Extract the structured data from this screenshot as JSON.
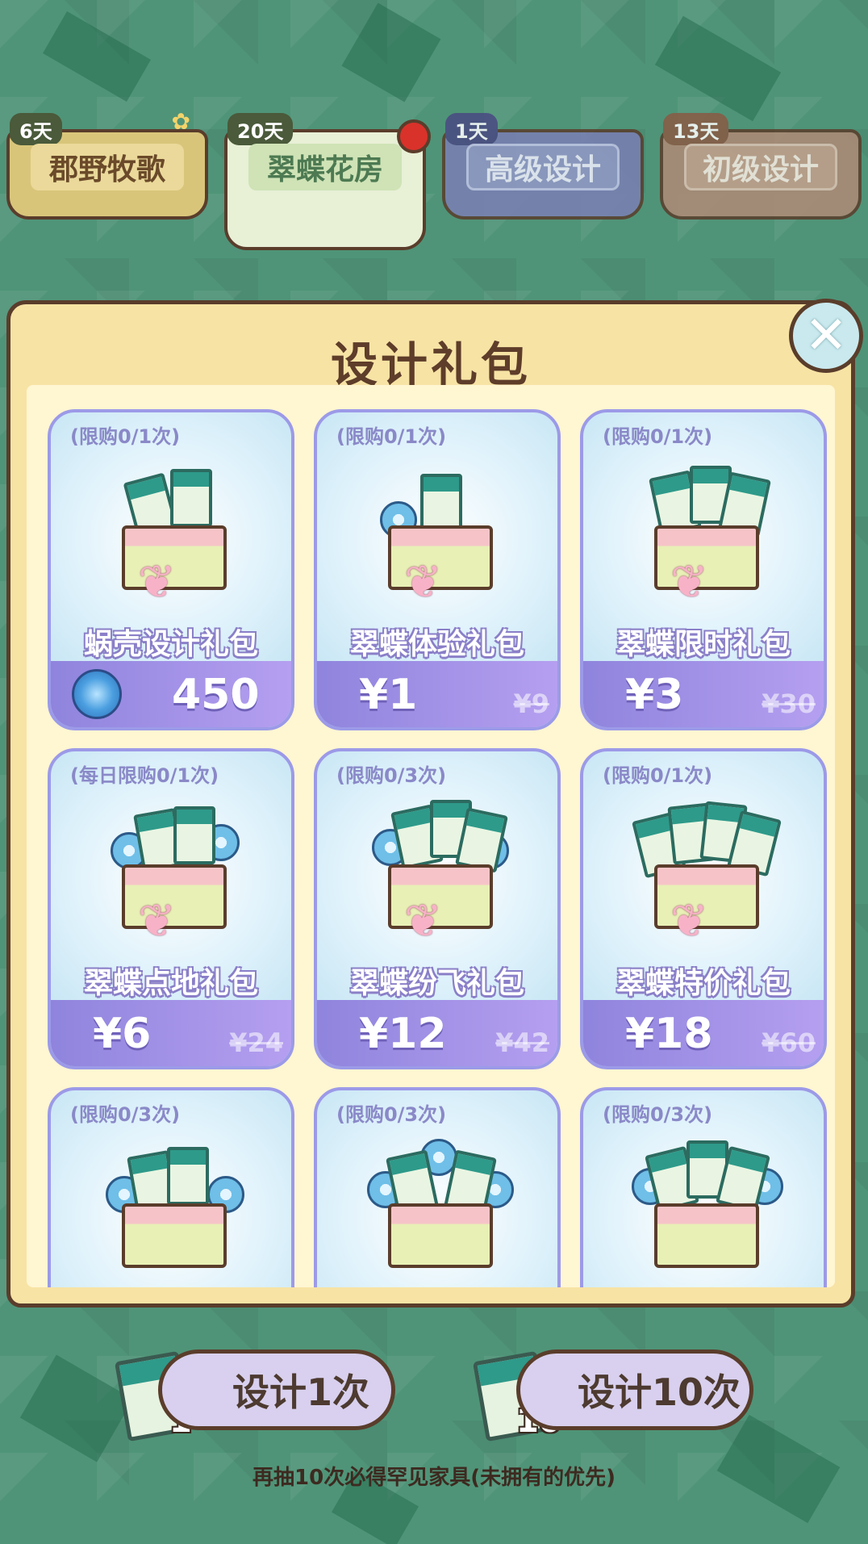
{
  "tabs": [
    {
      "days": "6天",
      "label": "郡野牧歌"
    },
    {
      "days": "20天",
      "label": "翠蝶花房"
    },
    {
      "days": "1天",
      "label": "高级设计"
    },
    {
      "days": "13天",
      "label": "初级设计"
    }
  ],
  "panel": {
    "title": "设计礼包"
  },
  "cards": [
    {
      "limit": "(限购0/1次)",
      "name": "蜗壳设计礼包",
      "price": "450",
      "orig": ""
    },
    {
      "limit": "(限购0/1次)",
      "name": "翠蝶体验礼包",
      "price": "¥1",
      "orig": "¥9"
    },
    {
      "limit": "(限购0/1次)",
      "name": "翠蝶限时礼包",
      "price": "¥3",
      "orig": "¥30"
    },
    {
      "limit": "(每日限购0/1次)",
      "name": "翠蝶点地礼包",
      "price": "¥6",
      "orig": "¥24"
    },
    {
      "limit": "(限购0/3次)",
      "name": "翠蝶纷飞礼包",
      "price": "¥12",
      "orig": "¥42"
    },
    {
      "limit": "(限购0/1次)",
      "name": "翠蝶特价礼包",
      "price": "¥18",
      "orig": "¥60"
    },
    {
      "limit": "(限购0/3次)"
    },
    {
      "limit": "(限购0/3次)"
    },
    {
      "limit": "(限购0/3次)"
    }
  ],
  "buttons": {
    "design1": {
      "label": "设计1次",
      "count": "1"
    },
    "design10": {
      "label": "设计10次",
      "count": "10"
    }
  },
  "tip": "再抽10次必得罕见家具(未拥有的优先)",
  "colors": {
    "background": "#4f9478",
    "panel": "#f7e3a4",
    "accent": "#8f84dd",
    "border": "#5a3d2b"
  },
  "icons": {
    "close": "close-icon",
    "currency": "shell-swirl-icon",
    "ticket": "design-ticket-icon"
  }
}
